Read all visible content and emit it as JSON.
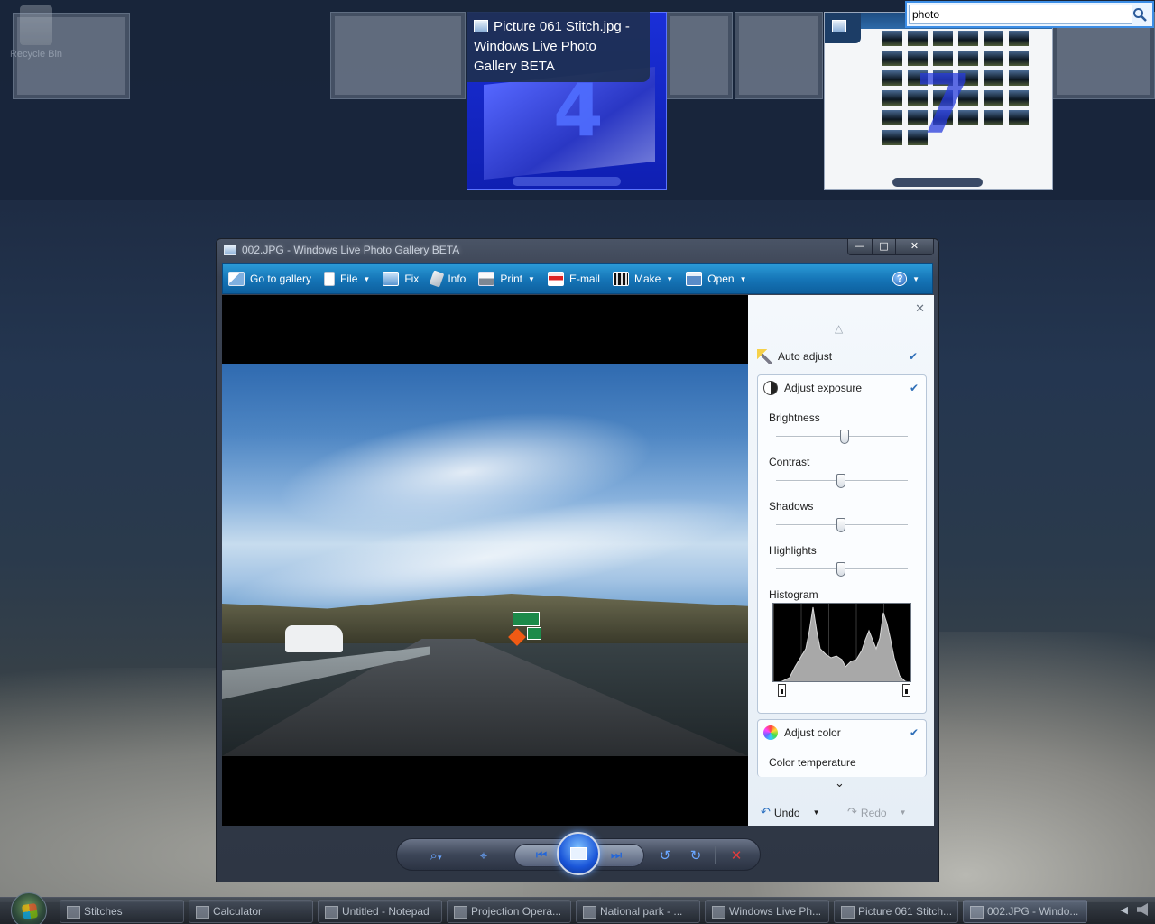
{
  "desktop": {
    "recycle_bin_label": "Recycle Bin"
  },
  "flip": {
    "active_tooltip": "Picture 061 Stitch.jpg - Windows Live Photo Gallery BETA",
    "active_number": "4",
    "gallery_number": "7"
  },
  "search": {
    "value": "photo",
    "icon": "magnifier-icon"
  },
  "window": {
    "title": "002.JPG - Windows Live Photo Gallery BETA",
    "controls": {
      "minimize": "—",
      "maximize": "□",
      "close": "✕"
    }
  },
  "toolbar": {
    "items": [
      {
        "label": "Go to gallery",
        "icon": "gallery-icon",
        "dropdown": false
      },
      {
        "label": "File",
        "icon": "file-icon",
        "dropdown": true
      },
      {
        "label": "Fix",
        "icon": "fix-icon",
        "dropdown": false
      },
      {
        "label": "Info",
        "icon": "info-tag-icon",
        "dropdown": false
      },
      {
        "label": "Print",
        "icon": "printer-icon",
        "dropdown": true
      },
      {
        "label": "E-mail",
        "icon": "email-icon",
        "dropdown": false
      },
      {
        "label": "Make",
        "icon": "film-icon",
        "dropdown": true
      },
      {
        "label": "Open",
        "icon": "open-icon",
        "dropdown": true
      }
    ],
    "help_label": "?",
    "caret": "▼"
  },
  "panel": {
    "close": "✕",
    "scroll_up": "△",
    "scroll_down": "⌄",
    "check": "✔",
    "auto_adjust": "Auto adjust",
    "adjust_exposure": "Adjust exposure",
    "sliders": [
      {
        "label": "Brightness",
        "value": 0.52
      },
      {
        "label": "Contrast",
        "value": 0.49
      },
      {
        "label": "Shadows",
        "value": 0.49
      },
      {
        "label": "Highlights",
        "value": 0.49
      }
    ],
    "histogram_label": "Histogram",
    "histogram_markers": [
      0.0,
      1.0
    ],
    "adjust_color": "Adjust color",
    "color_temperature": "Color temperature",
    "undo": "Undo",
    "redo": "Redo",
    "undo_icon": "↶",
    "redo_icon": "↷"
  },
  "controls": {
    "zoom": "⌕",
    "fit": "⌖",
    "prev": "⏮",
    "next": "⏭",
    "rotate_left": "↺",
    "rotate_right": "↻",
    "delete": "✕",
    "caret": "▾"
  },
  "taskbar": {
    "tasks": [
      {
        "label": "Stitches",
        "active": false
      },
      {
        "label": "Calculator",
        "active": false
      },
      {
        "label": "Untitled - Notepad",
        "active": false
      },
      {
        "label": "Projection Opera...",
        "active": false
      },
      {
        "label": "National park - ...",
        "active": false
      },
      {
        "label": "Windows Live Ph...",
        "active": false
      },
      {
        "label": "Picture 061 Stitch...",
        "active": false
      },
      {
        "label": "002.JPG - Windo...",
        "active": true
      }
    ],
    "tray_arrow": "◀"
  },
  "colors": {
    "toolbar_blue": "#1676b8",
    "accent": "#2f6fb8",
    "delete_red": "#e23c3c"
  }
}
